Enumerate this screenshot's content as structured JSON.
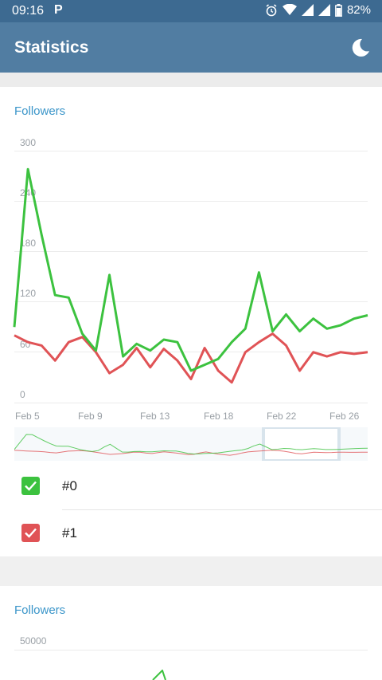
{
  "status": {
    "time": "09:16",
    "battery": "82%"
  },
  "app_bar": {
    "title": "Statistics",
    "theme_icon": "moon-icon"
  },
  "cards": [
    {
      "title": "Followers",
      "legend": [
        {
          "label": "#0",
          "color": "#3cc23f",
          "checked": true
        },
        {
          "label": "#1",
          "color": "#e05356",
          "checked": true
        }
      ]
    },
    {
      "title": "Followers",
      "y_tick": "50000"
    }
  ],
  "chart_data": {
    "type": "line",
    "title": "Followers",
    "y_ticks": [
      "300",
      "240",
      "180",
      "120",
      "60",
      "0"
    ],
    "ylim": [
      0,
      300
    ],
    "x_ticks": [
      "Feb 5",
      "Feb 9",
      "Feb 13",
      "Feb 18",
      "Feb 22",
      "Feb 26"
    ],
    "x_index": [
      0,
      1,
      2,
      3,
      4,
      5,
      6,
      7,
      8,
      9,
      10,
      11,
      12,
      13,
      14,
      15,
      16,
      17,
      18,
      19,
      20,
      21,
      22,
      23,
      24,
      25,
      26
    ],
    "series": [
      {
        "name": "#0",
        "color": "#3cc23f",
        "values": [
          90,
          278,
          200,
          128,
          125,
          82,
          62,
          152,
          55,
          70,
          62,
          75,
          72,
          38,
          45,
          52,
          72,
          88,
          155,
          85,
          105,
          85,
          100,
          88,
          92,
          100,
          104
        ]
      },
      {
        "name": "#1",
        "color": "#e05356",
        "values": [
          80,
          72,
          68,
          50,
          72,
          78,
          60,
          35,
          45,
          65,
          42,
          64,
          50,
          28,
          65,
          38,
          24,
          60,
          72,
          82,
          68,
          38,
          60,
          55,
          60,
          58,
          60
        ]
      }
    ],
    "grid": true
  }
}
